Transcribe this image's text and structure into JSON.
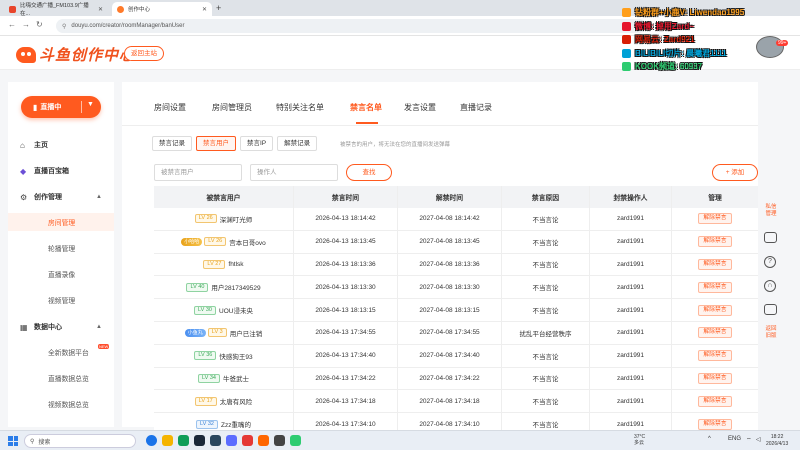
{
  "browser": {
    "tabs": [
      {
        "title": "比嗨交通广播_FM103.9广播在..."
      },
      {
        "title": "创作中心"
      }
    ],
    "url": "douyu.com/creator/roomManager/banUser"
  },
  "header": {
    "logo_text": "斗鱼创作中心",
    "back_button": "返回主站"
  },
  "overlay": {
    "lines": [
      {
        "text": "钻粉群+小鹿V: Liwendao1995",
        "color": "#ff9f1c"
      },
      {
        "text": "微博: 掉用Zard~",
        "color": "#e6162d"
      },
      {
        "text": "网易云: Zard921",
        "color": "#d81e06"
      },
      {
        "text": "BILIBILI切片: 晨曦君1111",
        "color": "#00a1d6"
      },
      {
        "text": "KOOK频道: 60937",
        "color": "#2ecc71"
      }
    ],
    "badge": "99+"
  },
  "sidebar": {
    "live_button": "直播中",
    "items": [
      {
        "label": "主页",
        "type": "group"
      },
      {
        "label": "直播百宝箱",
        "type": "group"
      },
      {
        "label": "创作管理",
        "type": "group"
      },
      {
        "label": "房间管理",
        "type": "sub",
        "active": true
      },
      {
        "label": "轮播管理",
        "type": "sub"
      },
      {
        "label": "直播录像",
        "type": "sub"
      },
      {
        "label": "视频管理",
        "type": "sub"
      },
      {
        "label": "数据中心",
        "type": "group"
      },
      {
        "label": "全新数据平台",
        "type": "sub",
        "tag": "NEW"
      },
      {
        "label": "直播数据总览",
        "type": "sub"
      },
      {
        "label": "视频数据总览",
        "type": "sub"
      }
    ]
  },
  "main": {
    "tabs": [
      "房间设置",
      "房间管理员",
      "特别关注名单",
      "禁言名单",
      "发言设置",
      "直播记录"
    ],
    "active_tab": "禁言名单",
    "subtabs": [
      "禁言记录",
      "禁言用户",
      "禁言IP",
      "解禁记录"
    ],
    "active_subtab": "禁言用户",
    "hint": "被禁言的用户，将无法在您的直播间发送弹幕",
    "filter": {
      "user_placeholder": "被禁言用户",
      "operator_placeholder": "操作人",
      "search_button": "查找",
      "add_button": "+ 添加"
    },
    "table": {
      "headers": [
        "被禁言用户",
        "禁言时间",
        "解禁时间",
        "禁言原因",
        "封禁操作人",
        "管理"
      ],
      "rows": [
        {
          "fan": "",
          "level": "LV 26",
          "level_color": "y",
          "user": "深渊叮光师",
          "ban_time": "2026-04-13 18:14:42",
          "unban_time": "2027-04-08 18:14:42",
          "reason": "不当言论",
          "operator": "zard1991",
          "action": "解除禁言"
        },
        {
          "fan": "小哈哈",
          "fan_color": "gold",
          "level": "LV 26",
          "level_color": "y",
          "user": "宫本日哥ovo",
          "ban_time": "2026-04-13 18:13:45",
          "unban_time": "2027-04-08 18:13:45",
          "reason": "不当言论",
          "operator": "zard1991",
          "action": "解除禁言"
        },
        {
          "fan": "",
          "level": "LV 27",
          "level_color": "y",
          "user": "fhtlsk",
          "ban_time": "2026-04-13 18:13:36",
          "unban_time": "2027-04-08 18:13:36",
          "reason": "不当言论",
          "operator": "zard1991",
          "action": "解除禁言"
        },
        {
          "fan": "",
          "level": "LV 40",
          "level_color": "g",
          "user": "用户2817349529",
          "ban_time": "2026-04-13 18:13:30",
          "unban_time": "2027-04-08 18:13:30",
          "reason": "不当言论",
          "operator": "zard1991",
          "action": "解除禁言"
        },
        {
          "fan": "",
          "level": "LV 30",
          "level_color": "g",
          "user": "UOU浸未央",
          "ban_time": "2026-04-13 18:13:15",
          "unban_time": "2027-04-08 18:13:15",
          "reason": "不当言论",
          "operator": "zard1991",
          "action": "解除禁言"
        },
        {
          "fan": "小鱼丸",
          "fan_color": "blue",
          "level": "LV 3",
          "level_color": "y",
          "user": "用户已注销",
          "ban_time": "2026-04-13 17:34:55",
          "unban_time": "2027-04-08 17:34:55",
          "reason": "扰乱平台经营秩序",
          "operator": "zard1991",
          "action": "解除禁言"
        },
        {
          "fan": "",
          "level": "LV 36",
          "level_color": "g",
          "user": "快感狗王93",
          "ban_time": "2026-04-13 17:34:40",
          "unban_time": "2027-04-08 17:34:40",
          "reason": "不当言论",
          "operator": "zard1991",
          "action": "解除禁言"
        },
        {
          "fan": "",
          "level": "LV 34",
          "level_color": "g",
          "user": "牛爸武士",
          "ban_time": "2026-04-13 17:34:22",
          "unban_time": "2027-04-08 17:34:22",
          "reason": "不当言论",
          "operator": "zard1991",
          "action": "解除禁言"
        },
        {
          "fan": "",
          "level": "LV 17",
          "level_color": "y",
          "user": "太唐有风险",
          "ban_time": "2026-04-13 17:34:18",
          "unban_time": "2027-04-08 17:34:18",
          "reason": "不当言论",
          "operator": "zard1991",
          "action": "解除禁言"
        },
        {
          "fan": "",
          "level": "LV 32",
          "level_color": "b",
          "user": "Zzz重嘴的",
          "ban_time": "2026-04-13 17:34:10",
          "unban_time": "2027-04-08 17:34:10",
          "reason": "不当言论",
          "operator": "zard1991",
          "action": "解除禁言"
        }
      ]
    }
  },
  "right_tools": {
    "message": "私信\n管理",
    "back_old": "返回\n旧版"
  },
  "taskbar": {
    "search": "搜索",
    "weather_temp": "37°C",
    "weather_desc": "多云",
    "lang": "ENG",
    "time": "18:22",
    "date": "2026/4/13"
  }
}
